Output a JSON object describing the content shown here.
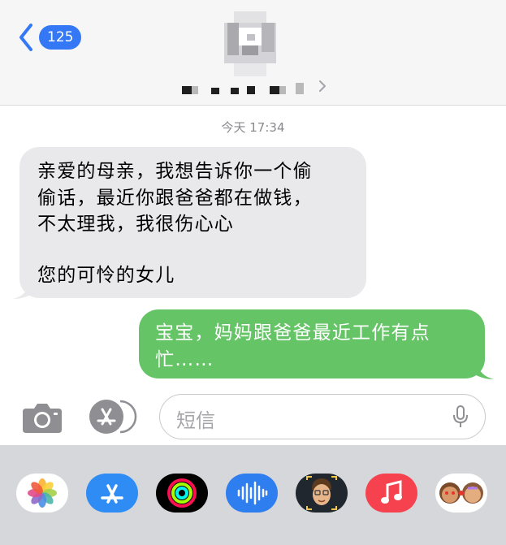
{
  "header": {
    "back_count": "125"
  },
  "timestamp": "今天 17:34",
  "messages": {
    "incoming": {
      "lines": [
        "亲爱的母亲，我想告诉你一个偷",
        "偷话，最近你跟爸爸都在做钱，",
        "不太理我，我很伤心心",
        "您的可怜的女儿"
      ]
    },
    "outgoing": {
      "lines": [
        "宝宝，妈妈跟爸爸最近工作有点",
        "忙……"
      ]
    }
  },
  "input": {
    "placeholder": "短信"
  },
  "icons": {
    "back": "chevron-left-icon",
    "camera": "camera-icon",
    "apps": "app-store-icon",
    "mic": "microphone-icon",
    "tray": [
      "photos-icon",
      "app-store-icon",
      "activity-icon",
      "audio-message-icon",
      "memoji-icon",
      "music-icon",
      "memoji-stickers-icon"
    ]
  },
  "colors": {
    "accent": "#3478f6",
    "incoming_bubble": "#e9e9eb",
    "outgoing_bubble": "#65c466"
  }
}
